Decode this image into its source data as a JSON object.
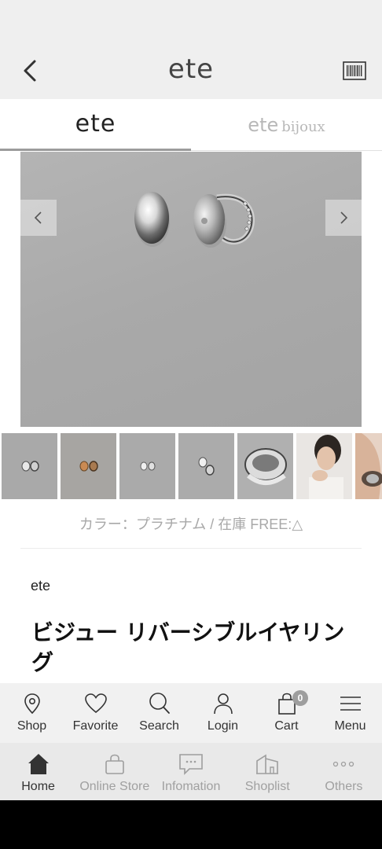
{
  "header": {
    "logo": "ete"
  },
  "brand_tabs": {
    "ete": "ete",
    "bijoux_ete": "ete",
    "bijoux_suffix": "bijoux"
  },
  "product": {
    "color_stock": "カラー：プラチナム / 在庫 FREE:△",
    "brand": "ete",
    "title": "ビジュー リバーシブルイヤリング"
  },
  "toolbar": {
    "shop": "Shop",
    "favorite": "Favorite",
    "search": "Search",
    "login": "Login",
    "cart": "Cart",
    "cart_count": "0",
    "menu": "Menu"
  },
  "tabbar": {
    "home": "Home",
    "online_store": "Online Store",
    "information": "Infomation",
    "shoplist": "Shoplist",
    "others": "Others"
  },
  "colors": {
    "active_tab": "#333333",
    "inactive_tab": "#a0a0a0",
    "image_bg": "#aaaaaa"
  }
}
